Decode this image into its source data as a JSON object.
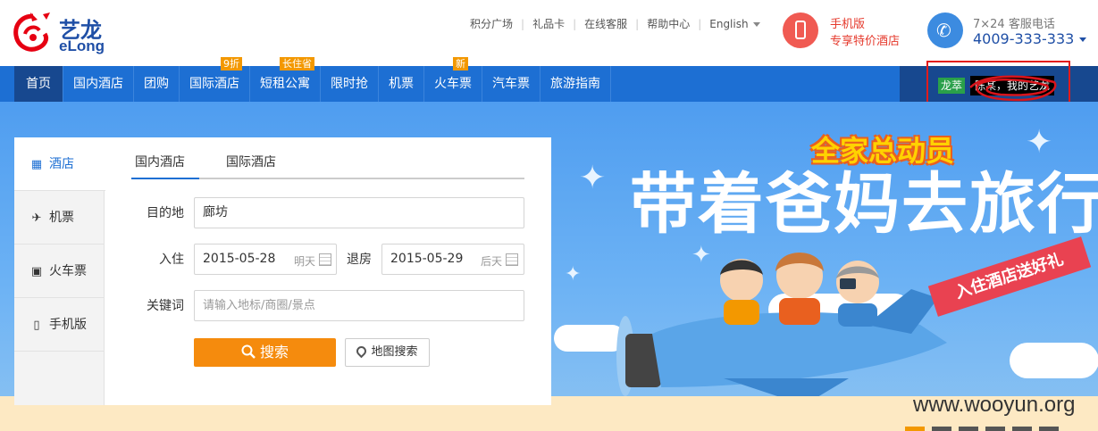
{
  "brand": {
    "name_cn": "艺龙",
    "name_en": "eLong",
    "logo_color": "#e60012"
  },
  "top_links": [
    {
      "label": "积分广场"
    },
    {
      "label": "礼品卡"
    },
    {
      "label": "在线客服"
    },
    {
      "label": "帮助中心"
    },
    {
      "label": "English"
    }
  ],
  "mobile_promo": {
    "title": "手机版",
    "subtitle": "专享特价酒店",
    "icon": "mobile-phone-icon"
  },
  "service": {
    "title": "7×24 客服电话",
    "phone": "4009-333-333",
    "icon": "telephone-icon"
  },
  "nav": {
    "items": [
      {
        "label": "首页",
        "badge": ""
      },
      {
        "label": "国内酒店",
        "badge": ""
      },
      {
        "label": "团购",
        "badge": ""
      },
      {
        "label": "国际酒店",
        "badge": "9折"
      },
      {
        "label": "短租公寓",
        "badge": "长住省"
      },
      {
        "label": "限时抢",
        "badge": ""
      },
      {
        "label": "机票",
        "badge": ""
      },
      {
        "label": "火车票",
        "badge": "新"
      },
      {
        "label": "汽车票",
        "badge": ""
      },
      {
        "label": "旅游指南",
        "badge": ""
      }
    ],
    "active_index": 0
  },
  "user": {
    "level_tag": "龙萃",
    "greeting": "陈某，我的艺龙"
  },
  "search_panel": {
    "side_tabs": [
      {
        "label": "酒店",
        "icon": "hotel-icon",
        "active": true
      },
      {
        "label": "机票",
        "icon": "plane-icon",
        "active": false
      },
      {
        "label": "火车票",
        "icon": "train-icon",
        "active": false
      },
      {
        "label": "手机版",
        "icon": "mobile-icon",
        "active": false
      }
    ],
    "tabs": [
      {
        "label": "国内酒店",
        "active": true
      },
      {
        "label": "国际酒店",
        "active": false
      }
    ],
    "destination": {
      "label": "目的地",
      "value": "廊坊"
    },
    "checkin": {
      "label": "入住",
      "value": "2015-05-28",
      "hint": "明天"
    },
    "checkout": {
      "label": "退房",
      "value": "2015-05-29",
      "hint": "后天"
    },
    "keyword": {
      "label": "关键词",
      "placeholder": "请输入地标/商圈/景点"
    },
    "search_button": "搜索",
    "map_button": "地图搜索"
  },
  "banner": {
    "slogan_top": "全家总动员",
    "slogan_main": "带着爸妈去旅行",
    "ribbon": "入住酒店送好礼",
    "slides": 6,
    "active_slide": 0
  },
  "watermark": "www.wooyun.org",
  "colors": {
    "nav_blue": "#1d6fd3",
    "nav_dark": "#17488f",
    "accent_orange": "#f58b0d",
    "badge_orange": "#f39800",
    "highlight_red": "#e31b1b"
  }
}
